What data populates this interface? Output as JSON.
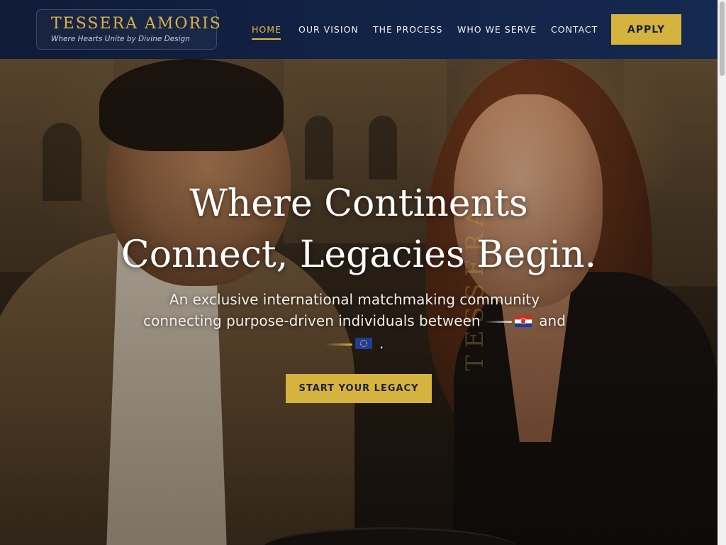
{
  "brand": {
    "name": "TESSERA AMORIS",
    "tagline": "Where Hearts Unite by Divine Design",
    "watermark": "TESSERA"
  },
  "nav": {
    "items": [
      {
        "label": "HOME",
        "active": true
      },
      {
        "label": "OUR VISION",
        "active": false
      },
      {
        "label": "THE PROCESS",
        "active": false
      },
      {
        "label": "WHO WE SERVE",
        "active": false
      },
      {
        "label": "CONTACT",
        "active": false
      }
    ],
    "apply_label": "APPLY"
  },
  "hero": {
    "title_line1": "Where Continents",
    "title_line2": "Connect, Legacies Begin.",
    "subtitle_part1": "An exclusive international matchmaking community connecting purpose-driven individuals between",
    "subtitle_and": "and",
    "subtitle_end": ".",
    "flag1_icon": "croatia-flag-icon",
    "flag2_icon": "eu-flag-icon",
    "cta_label": "START YOUR LEGACY"
  },
  "colors": {
    "header_bg": "#132448",
    "gold_accent": "#d6b23f",
    "nav_active": "#e0b94a",
    "hero_text": "#ffffff"
  }
}
